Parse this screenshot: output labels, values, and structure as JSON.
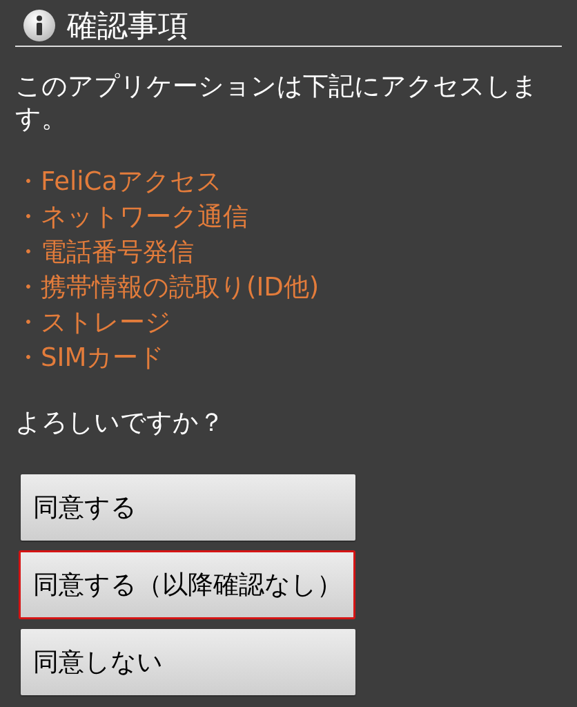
{
  "dialog": {
    "title": "確認事項",
    "message": "このアプリケーションは下記にアクセスします。",
    "permissions": [
      "・FeliCaアクセス",
      "・ネットワーク通信",
      "・電話番号発信",
      "・携帯情報の読取り(ID他)",
      "・ストレージ",
      "・SIMカード"
    ],
    "question": "よろしいですか？",
    "buttons": [
      {
        "label": "同意する",
        "selected": false
      },
      {
        "label": "同意する（以降確認なし）",
        "selected": true
      },
      {
        "label": "同意しない",
        "selected": false
      }
    ]
  }
}
